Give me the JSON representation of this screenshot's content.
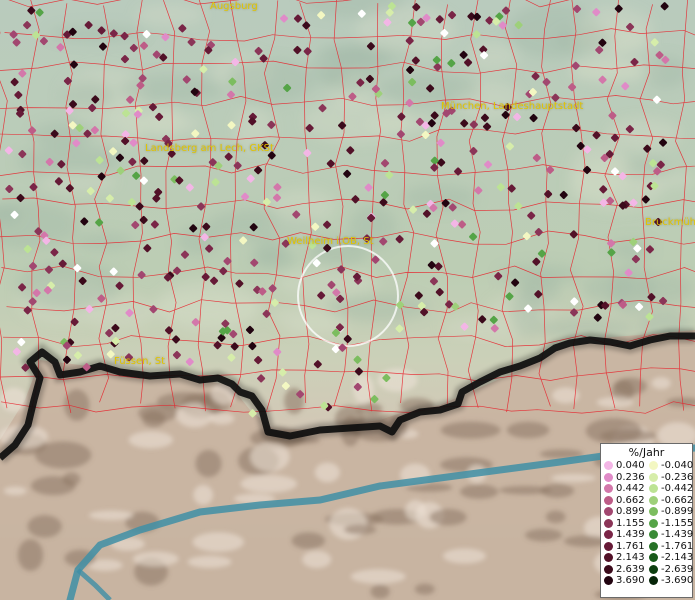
{
  "map": {
    "cities": [
      {
        "name": "augsburg",
        "label": "Augsburg"
      },
      {
        "name": "muenchen",
        "label": "München, Landeshauptstadt"
      },
      {
        "name": "landsberg",
        "label": "Landsberg am Lech, GKSt"
      },
      {
        "name": "weilheim",
        "label": "Weilheim i.OB, St"
      },
      {
        "name": "fuessen",
        "label": "Füssen, St"
      },
      {
        "name": "bruckmuehl",
        "label": "Bruckmüh"
      }
    ],
    "colors": {
      "terrain_green": "#b9c8b5",
      "borders": "#e8202a",
      "alps_rock": "#c7b39f",
      "river": "#3f8fa6",
      "state_border": "#111111",
      "city_label": "#e2c400"
    }
  },
  "legend": {
    "title": "%/Jahr",
    "positive": [
      {
        "value": "0.040",
        "color": "#f3b6e6"
      },
      {
        "value": "0.236",
        "color": "#e08bc8"
      },
      {
        "value": "0.442",
        "color": "#d377aa"
      },
      {
        "value": "0.662",
        "color": "#bd5c87"
      },
      {
        "value": "0.899",
        "color": "#a24770"
      },
      {
        "value": "1.155",
        "color": "#8b3558"
      },
      {
        "value": "1.439",
        "color": "#7a2547"
      },
      {
        "value": "1.761",
        "color": "#661a37"
      },
      {
        "value": "2.143",
        "color": "#521128"
      },
      {
        "value": "2.639",
        "color": "#3b0a1b"
      },
      {
        "value": "3.690",
        "color": "#220410"
      }
    ],
    "negative": [
      {
        "value": "-0.040",
        "color": "#f3f7c2"
      },
      {
        "value": "-0.236",
        "color": "#d6edaa"
      },
      {
        "value": "-0.442",
        "color": "#bce394"
      },
      {
        "value": "-0.662",
        "color": "#9ed07a"
      },
      {
        "value": "-0.899",
        "color": "#7cbd5f"
      },
      {
        "value": "-1.155",
        "color": "#55a447"
      },
      {
        "value": "-1.439",
        "color": "#3a8b36"
      },
      {
        "value": "-1.761",
        "color": "#277227"
      },
      {
        "value": "-2.143",
        "color": "#185a1a"
      },
      {
        "value": "-2.639",
        "color": "#0d3f10"
      },
      {
        "value": "-3.690",
        "color": "#062508"
      }
    ]
  }
}
